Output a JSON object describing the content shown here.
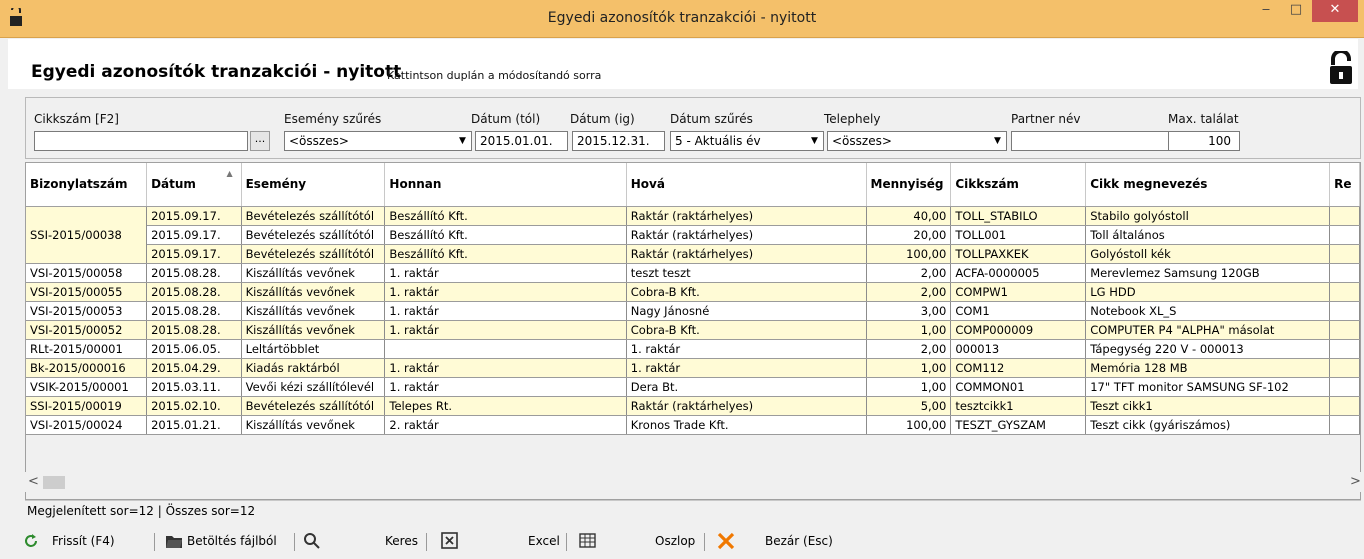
{
  "window": {
    "title": "Egyedi azonosítók tranzakciói - nyitott",
    "min_label": "‒",
    "max_label": "□",
    "close_label": "✕"
  },
  "header": {
    "title": "Egyedi azonosítók tranzakciói - nyitott",
    "hint": "Kattintson duplán a módosítandó sorra"
  },
  "filters": {
    "cikkszam_label": "Cikkszám [F2]",
    "cikkszam_value": "",
    "browse_label": "...",
    "esemeny_label": "Esemény szűrés",
    "esemeny_value": "<összes>",
    "datum_tol_label": "Dátum (tól)",
    "datum_tol_value": "2015.01.01.",
    "datum_ig_label": "Dátum (ig)",
    "datum_ig_value": "2015.12.31.",
    "datum_szures_label": "Dátum szűrés",
    "datum_szures_value": "5 - Aktuális év",
    "telephely_label": "Telephely",
    "telephely_value": "<összes>",
    "partner_label": "Partner név",
    "partner_value": "",
    "max_label": "Max. találat",
    "max_value": "100"
  },
  "table": {
    "headers": [
      "Bizonylatszám",
      "Dátum",
      "Esemény",
      "Honnan",
      "Hová",
      "Mennyiség",
      "Cikkszám",
      "Cikk megnevezés",
      "Re"
    ],
    "group_doc": "SSI-2015/00038",
    "rows": [
      {
        "doc": "",
        "date": "2015.09.17.",
        "event": "Bevételezés szállítótól",
        "from": "Beszállító Kft.",
        "to": "Raktár (raktárhelyes)",
        "qty": "40,00",
        "code": "TOLL_STABILO",
        "name": "Stabilo golyóstoll",
        "tone": "y"
      },
      {
        "doc": "",
        "date": "2015.09.17.",
        "event": "Bevételezés szállítótól",
        "from": "Beszállító Kft.",
        "to": "Raktár (raktárhelyes)",
        "qty": "20,00",
        "code": "TOLL001",
        "name": "Toll általános",
        "tone": "w"
      },
      {
        "doc": "",
        "date": "2015.09.17.",
        "event": "Bevételezés szállítótól",
        "from": "Beszállító Kft.",
        "to": "Raktár (raktárhelyes)",
        "qty": "100,00",
        "code": "TOLLPAXKEK",
        "name": "Golyóstoll kék",
        "tone": "y"
      },
      {
        "doc": "VSI-2015/00058",
        "date": "2015.08.28.",
        "event": "Kiszállítás vevőnek",
        "from": "1. raktár",
        "to": "teszt teszt",
        "qty": "2,00",
        "code": "ACFA-0000005",
        "name": "Merevlemez Samsung 120GB",
        "tone": "w"
      },
      {
        "doc": "VSI-2015/00055",
        "date": "2015.08.28.",
        "event": "Kiszállítás vevőnek",
        "from": "1. raktár",
        "to": "Cobra-B Kft.",
        "qty": "2,00",
        "code": "COMPW1",
        "name": "LG HDD",
        "tone": "y"
      },
      {
        "doc": "VSI-2015/00053",
        "date": "2015.08.28.",
        "event": "Kiszállítás vevőnek",
        "from": "1. raktár",
        "to": "Nagy Jánosné",
        "qty": "3,00",
        "code": "COM1",
        "name": "Notebook XL_S",
        "tone": "w"
      },
      {
        "doc": "VSI-2015/00052",
        "date": "2015.08.28.",
        "event": "Kiszállítás vevőnek",
        "from": "1. raktár",
        "to": "Cobra-B Kft.",
        "qty": "1,00",
        "code": "COMP000009",
        "name": "COMPUTER P4 \"ALPHA\" másolat",
        "tone": "y"
      },
      {
        "doc": "RLt-2015/00001",
        "date": "2015.06.05.",
        "event": "Leltártöbblet",
        "from": "",
        "to": "1. raktár",
        "qty": "2,00",
        "code": "000013",
        "name": "Tápegység 220 V - 000013",
        "tone": "w"
      },
      {
        "doc": "Bk-2015/000016",
        "date": "2015.04.29.",
        "event": "Kiadás raktárból",
        "from": "1. raktár",
        "to": "1. raktár",
        "qty": "1,00",
        "code": "COM112",
        "name": "Memória 128 MB",
        "tone": "y"
      },
      {
        "doc": "VSIK-2015/00001",
        "date": "2015.03.11.",
        "event": "Vevői kézi szállítólevél",
        "from": "1. raktár",
        "to": "Dera Bt.",
        "qty": "1,00",
        "code": "COMMON01",
        "name": "17\" TFT monitor SAMSUNG SF-102",
        "tone": "w"
      },
      {
        "doc": "SSI-2015/00019",
        "date": "2015.02.10.",
        "event": "Bevételezés szállítótól",
        "from": "Telepes Rt.",
        "to": "Raktár (raktárhelyes)",
        "qty": "5,00",
        "code": "tesztcikk1",
        "name": "Teszt cikk1",
        "tone": "y"
      },
      {
        "doc": "VSI-2015/00024",
        "date": "2015.01.21.",
        "event": "Kiszállítás vevőnek",
        "from": "2. raktár",
        "to": "Kronos Trade Kft.",
        "qty": "100,00",
        "code": "TESZT_GYSZAM",
        "name": "Teszt cikk (gyáriszámos)",
        "tone": "w"
      }
    ]
  },
  "status": {
    "text": "Megjelenített sor=12 | Összes sor=12"
  },
  "toolbar": {
    "refresh": "Frissít (F4)",
    "load": "Betöltés fájlból",
    "search": "Keres",
    "excel": "Excel",
    "column": "Oszlop",
    "close": "Bezár (Esc)"
  },
  "colors": {
    "titlebar": "#f4c06a",
    "row_yellow": "#fffbd6",
    "close_btn": "#c75050",
    "icon_orange": "#f07800",
    "icon_green": "#2e8b2e"
  }
}
